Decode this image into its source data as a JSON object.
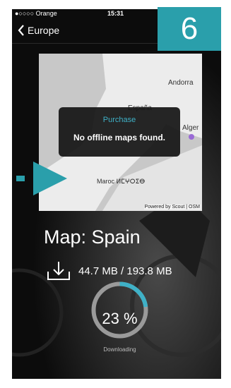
{
  "statusbar": {
    "carrier": "●○○○○ Orange",
    "time": "15:31",
    "right_icons": "◀ ✱ ▬ +"
  },
  "nav": {
    "back_label": "Europe"
  },
  "step_badge": "6",
  "map": {
    "labels": {
      "andorra": "Andorra",
      "espana": "España",
      "maroc": "Maroc ⵍⵎⵖⵔⵉⴱ",
      "alger": "Alger",
      "attribution": "Powered by Scout | OSM"
    }
  },
  "dialog": {
    "title": "Purchase",
    "message": "No offline maps found."
  },
  "download": {
    "map_title": "Map: Spain",
    "size_text": "44.7 MB / 193.8 MB",
    "percent_text": "23 %",
    "progress": 0.23,
    "status_text": "Downloading"
  },
  "colors": {
    "accent": "#3fb1c7",
    "badge": "#2a9fab"
  }
}
